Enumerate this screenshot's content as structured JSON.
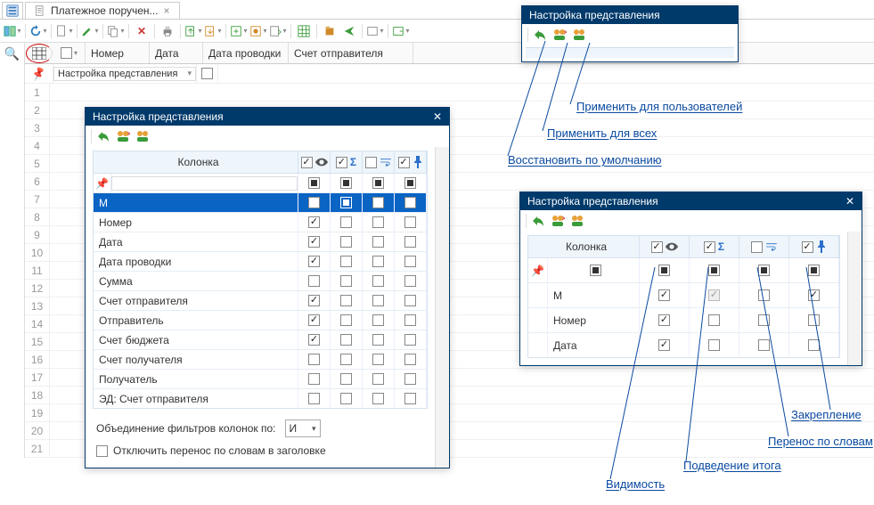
{
  "tab": {
    "title": "Платежное поручен..."
  },
  "grid": {
    "filter_label": "Настройка представления",
    "columns": [
      "Номер",
      "Дата",
      "Дата проводки",
      "Счет отправителя"
    ],
    "rows": [
      1,
      2,
      3,
      4,
      5,
      6,
      7,
      8,
      9,
      10,
      11,
      12,
      13,
      14,
      15,
      16,
      17,
      18,
      19,
      20,
      21
    ]
  },
  "dialog1": {
    "title": "Настройка представления",
    "col_header": "Колонка",
    "rows": [
      {
        "name": "М",
        "vis": "checked",
        "sum": "empty-dark",
        "wrap": "checked",
        "pin": "empty",
        "selected": true
      },
      {
        "name": "Номер",
        "vis": "checked",
        "sum": "empty",
        "wrap": "empty",
        "pin": "empty"
      },
      {
        "name": "Дата",
        "vis": "checked",
        "sum": "empty",
        "wrap": "empty",
        "pin": "empty"
      },
      {
        "name": "Дата проводки",
        "vis": "checked",
        "sum": "empty",
        "wrap": "empty",
        "pin": "empty"
      },
      {
        "name": "Сумма",
        "vis": "empty",
        "sum": "empty",
        "wrap": "empty",
        "pin": "empty"
      },
      {
        "name": "Счет отправителя",
        "vis": "checked",
        "sum": "empty",
        "wrap": "empty",
        "pin": "empty"
      },
      {
        "name": "Отправитель",
        "vis": "checked",
        "sum": "empty",
        "wrap": "empty",
        "pin": "empty"
      },
      {
        "name": "Счет бюджета",
        "vis": "checked",
        "sum": "empty",
        "wrap": "empty",
        "pin": "empty"
      },
      {
        "name": "Счет получателя",
        "vis": "empty",
        "sum": "empty",
        "wrap": "empty",
        "pin": "empty"
      },
      {
        "name": "Получатель",
        "vis": "empty",
        "sum": "empty",
        "wrap": "empty",
        "pin": "empty"
      },
      {
        "name": "ЭД: Счет отправителя",
        "vis": "empty",
        "sum": "empty",
        "wrap": "empty",
        "pin": "empty"
      }
    ],
    "filter_join_label": "Объединение фильтров колонок по:",
    "filter_join_value": "И",
    "wrap_off_label": "Отключить перенос по словам в заголовке"
  },
  "annot": {
    "apply_users": "Применить для пользователей",
    "apply_all": "Применить для всех",
    "restore_default": "Восстановить по умолчанию",
    "visibility": "Видимость",
    "summary": "Подведение итога",
    "wrap": "Перенос по словам",
    "pin": "Закрепление"
  },
  "dialog2": {
    "title": "Настройка представления",
    "col_header": "Колонка",
    "rows": [
      {
        "name": "М",
        "vis": "checked",
        "sum": "checked-disabled",
        "wrap": "empty",
        "pin": "checked"
      },
      {
        "name": "Номер",
        "vis": "checked",
        "sum": "empty",
        "wrap": "empty",
        "pin": "empty"
      },
      {
        "name": "Дата",
        "vis": "checked",
        "sum": "empty",
        "wrap": "empty",
        "pin": "empty"
      }
    ]
  }
}
